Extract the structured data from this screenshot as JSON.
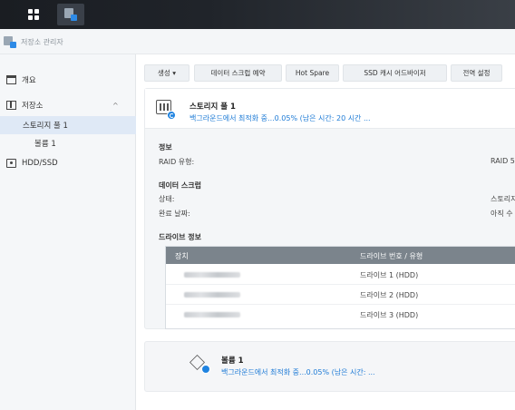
{
  "app": {
    "title": "저장소 관리자"
  },
  "taskbar": {
    "grid_icon": "grid-icon",
    "storage_icon": "storage-manager-icon"
  },
  "sidebar": {
    "items": [
      {
        "label": "개요",
        "icon": "overview-icon"
      },
      {
        "label": "저장소",
        "icon": "storage-icon",
        "chevron": "^"
      },
      {
        "label": "스토리지 풀 1"
      },
      {
        "label": "볼륨 1"
      },
      {
        "label": "HDD/SSD",
        "icon": "hdd-icon"
      }
    ]
  },
  "toolbar": {
    "create_label": "생성 ▾",
    "scrub_label": "데이터 스크럽 예약",
    "hot_spare_label": "Hot Spare",
    "ssd_cache_label": "SSD 캐시 어드바이저",
    "global_settings_label": "전역 설정"
  },
  "pool": {
    "title": "스토리지 풀 1",
    "status": "백그라운드에서 최적화 중...0.05% (남은 시간: 20 시간 ...",
    "info_title": "정보",
    "raid_label": "RAID 유형:",
    "raid_value": "RAID 5",
    "scrub_title": "데이터 스크럽",
    "state_label": "상태:",
    "state_value": "스토리지",
    "completed_label": "완료 날짜:",
    "completed_value": "아직 수",
    "drive_info_title": "드라이브 정보",
    "drive_table": {
      "headers": [
        "장치",
        "드라이브 번호 / 유형"
      ],
      "rows": [
        {
          "number": "드라이브 1 (HDD)"
        },
        {
          "number": "드라이브 2 (HDD)"
        },
        {
          "number": "드라이브 3 (HDD)"
        }
      ]
    }
  },
  "volume": {
    "title": "볼륨 1",
    "status": "백그라운드에서 최적화 중...0.05% (남은 시간: ..."
  },
  "colors": {
    "accent": "#1e7bd6",
    "selected": "#dfe9f6",
    "table_header": "#7b848c"
  }
}
